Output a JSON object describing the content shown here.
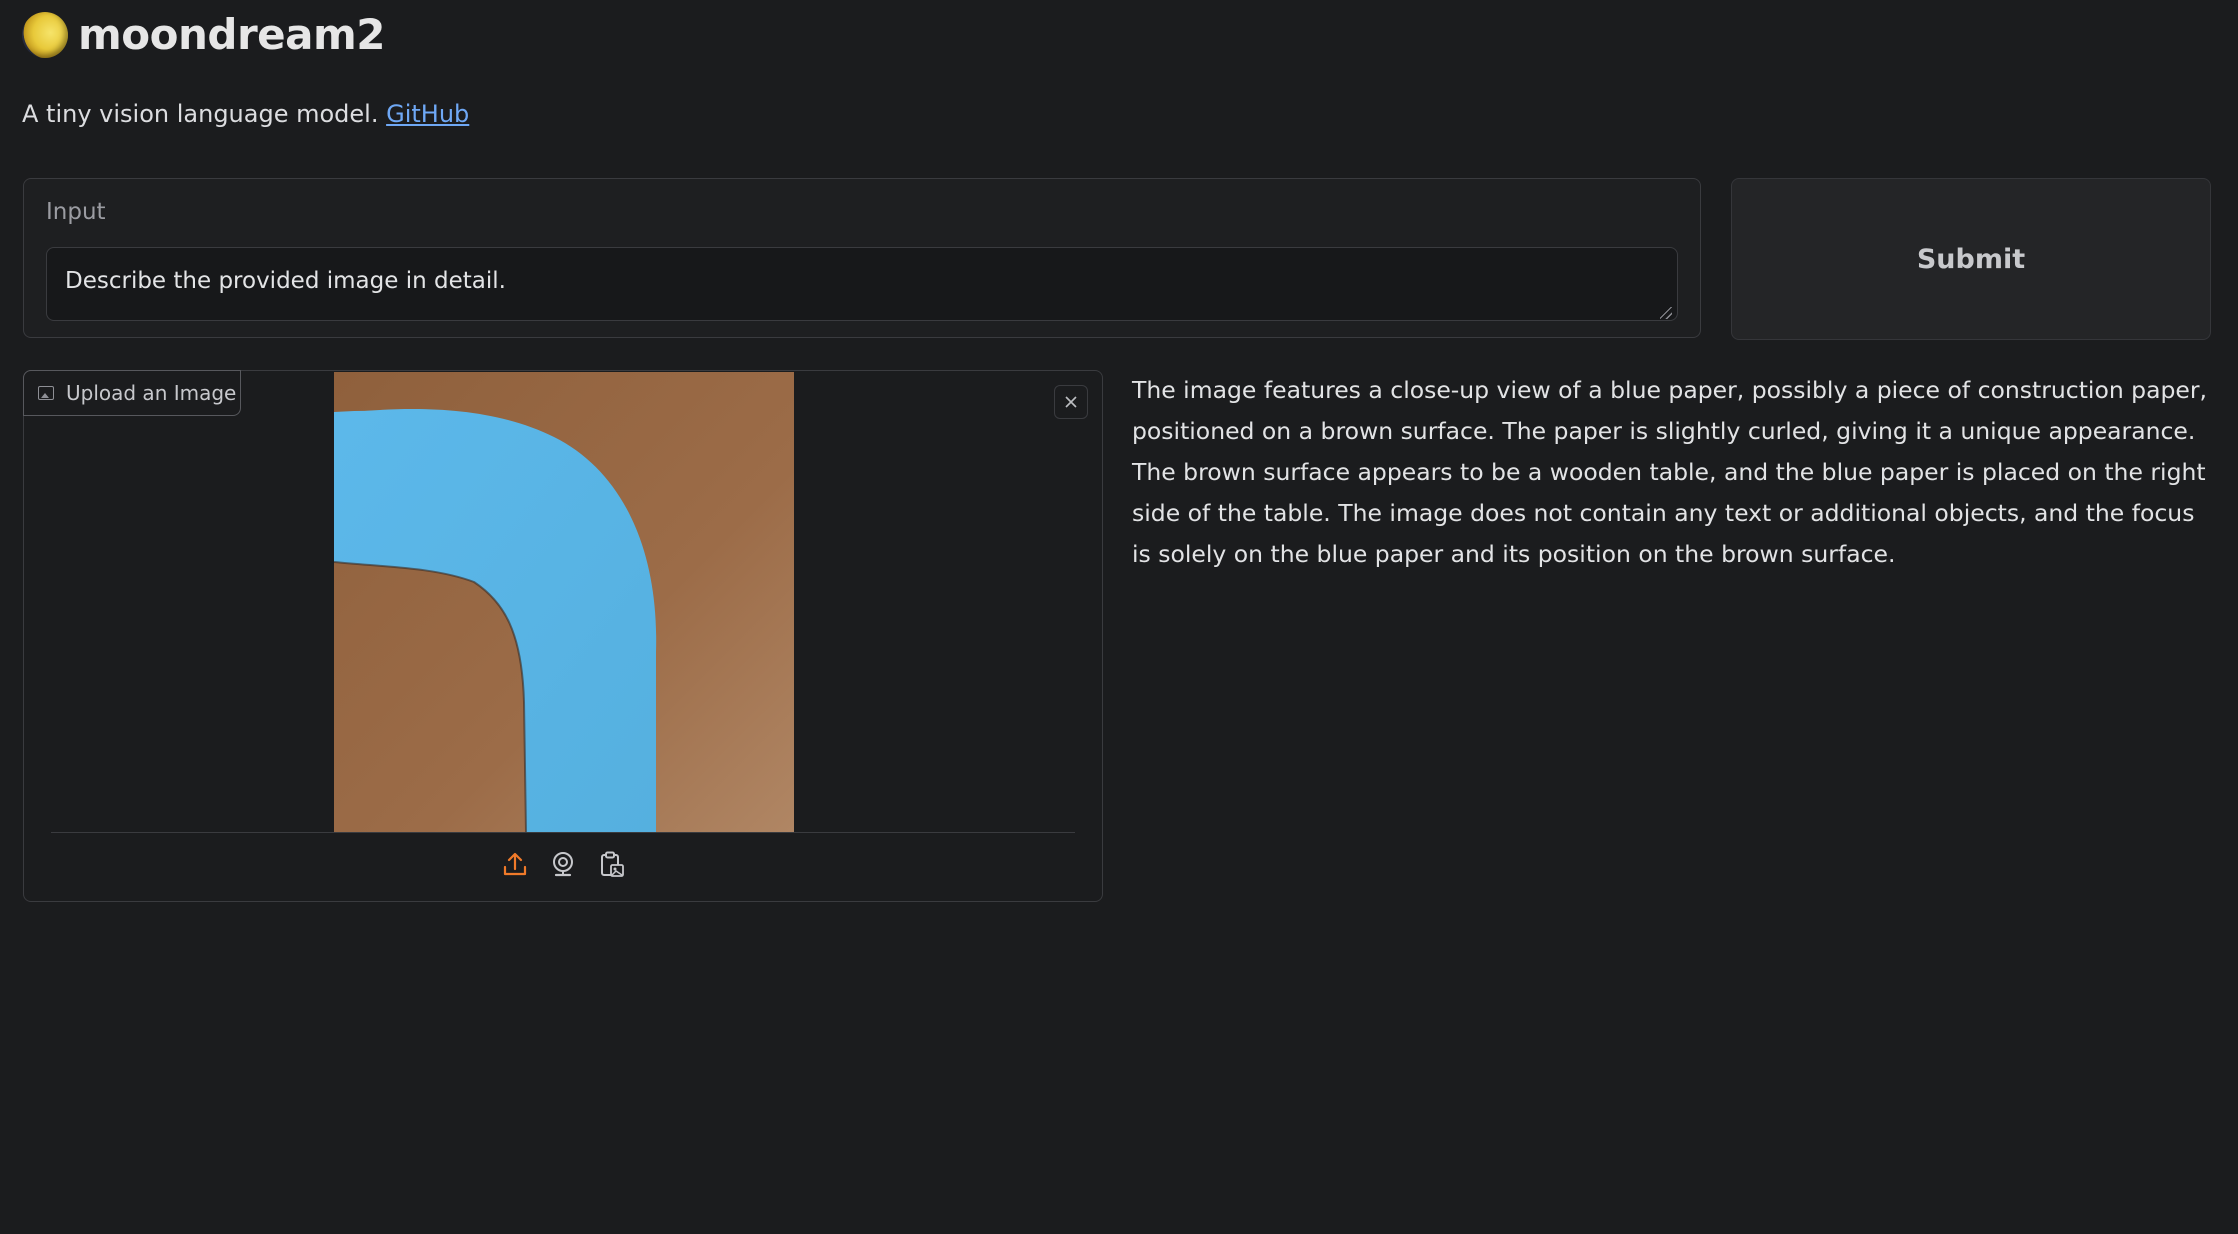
{
  "header": {
    "title": "moondream2",
    "subtitle_text": "A tiny vision language model.",
    "subtitle_link": "GitHub"
  },
  "input": {
    "label": "Input",
    "value": "Describe the provided image in detail."
  },
  "submit": {
    "label": "Submit"
  },
  "image_input": {
    "tab_label": "Upload an Image",
    "sources": [
      "upload-icon",
      "webcam-icon",
      "clipboard-icon"
    ],
    "active_source_color": "#f07a2a"
  },
  "output": {
    "text": "The image features a close-up view of a blue paper, possibly a piece of construction paper, positioned on a brown surface. The paper is slightly curled, giving it a unique appearance. The brown surface appears to be a wooden table, and the blue paper is placed on the right side of the table. The image does not contain any text or additional objects, and the focus is solely on the blue paper and its position on the brown surface."
  },
  "colors": {
    "background": "#1b1c1e",
    "link": "#6fa8f5",
    "paper_blue": "#5bb6e6",
    "surface_brown": "#9a6a45"
  }
}
